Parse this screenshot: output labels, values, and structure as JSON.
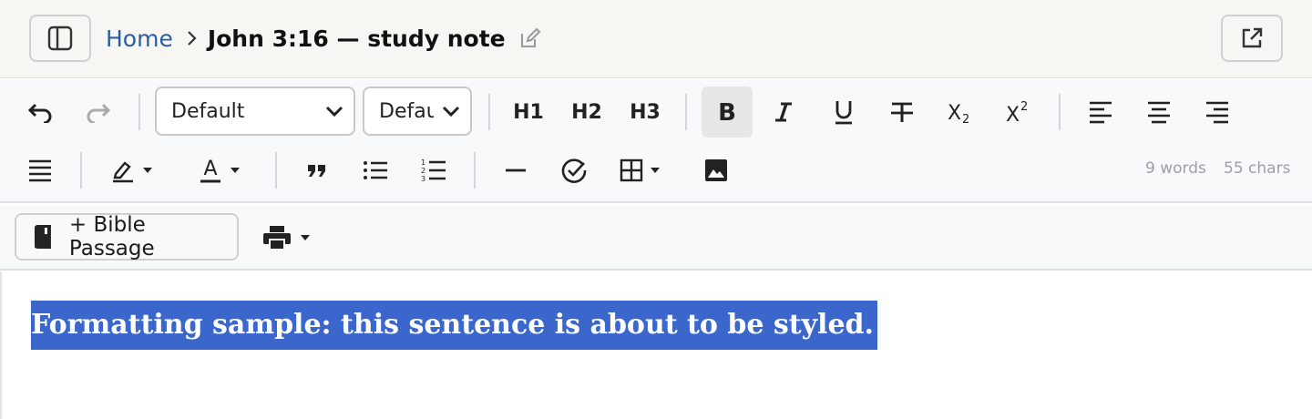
{
  "header": {
    "breadcrumb_home": "Home",
    "title": "John 3:16 — study note",
    "icons": {
      "sidebar_toggle": "sidebar-toggle-icon",
      "chevron": "chevron-right-icon",
      "edit": "pencil-icon",
      "external": "external-link-icon"
    }
  },
  "toolbar": {
    "font_family": "Default",
    "font_size": "Default",
    "h1": "H1",
    "h2": "H2",
    "h3": "H3",
    "word_count": "9 words",
    "char_count": "55 chars",
    "active_color": "#e6e7e9"
  },
  "toolbar2": {
    "bible_button": "+ Bible Passage"
  },
  "editor": {
    "selected_text": "Formatting sample: this sentence is about to be styled.",
    "selection_color": "#3b67cc"
  }
}
